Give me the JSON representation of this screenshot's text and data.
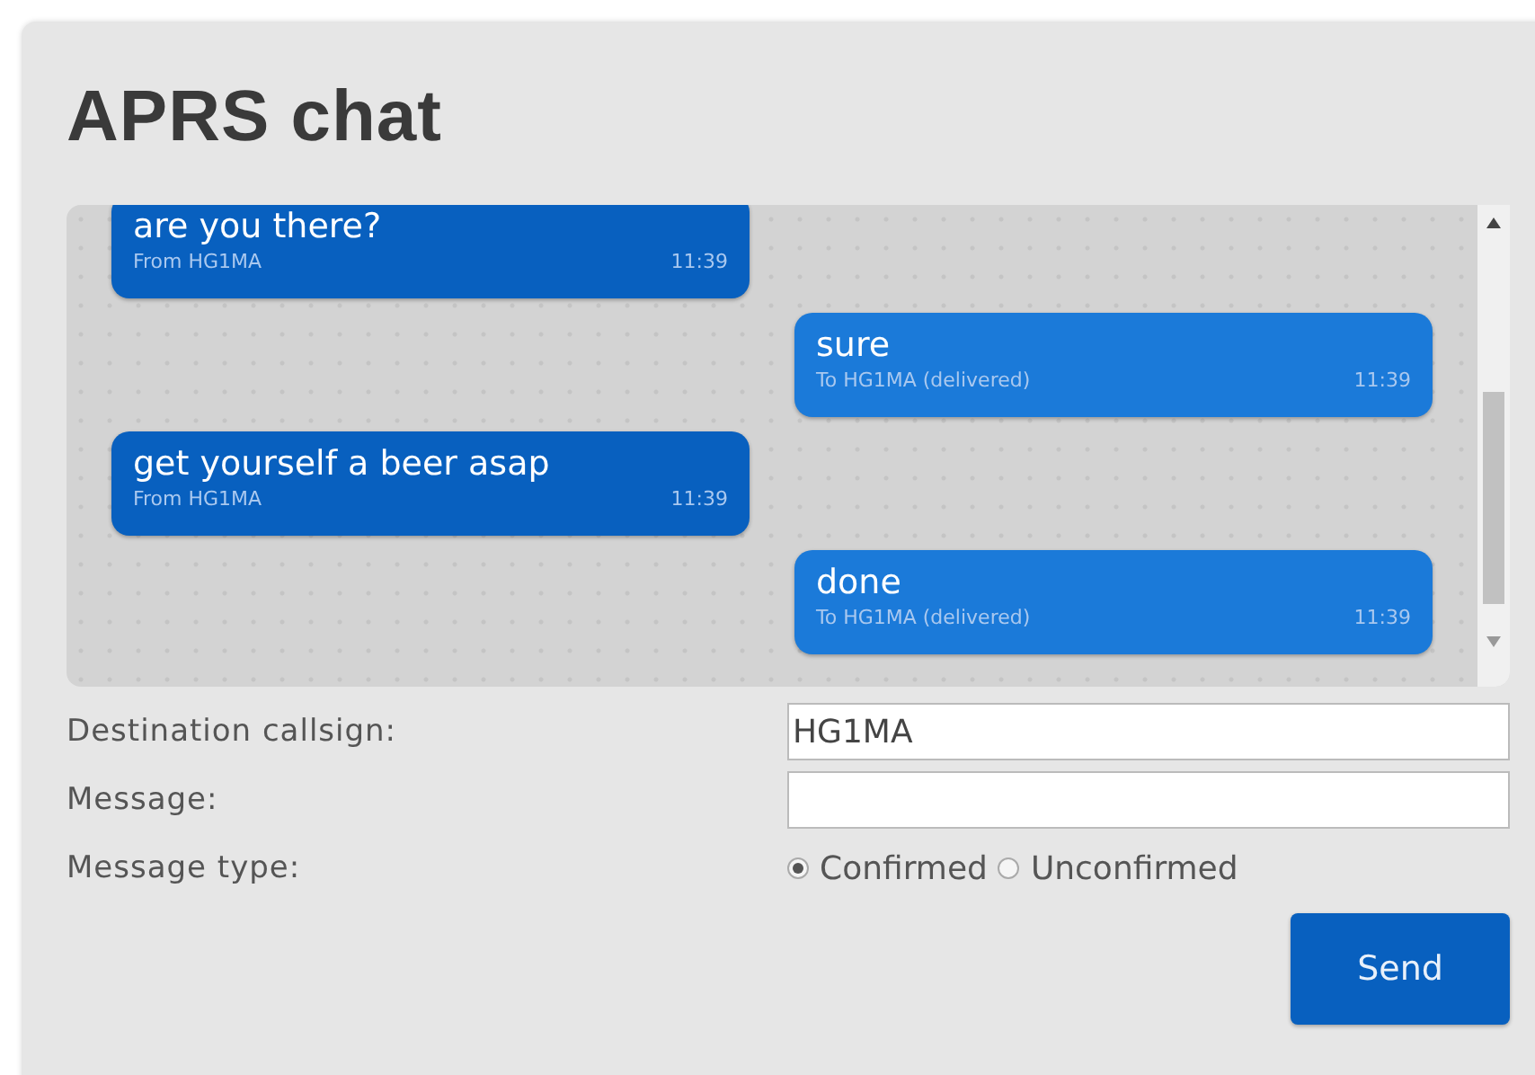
{
  "title": "APRS chat",
  "messages": [
    {
      "kind": "incoming",
      "text": "are you there?",
      "meta": "From HG1MA",
      "time": "11:39"
    },
    {
      "kind": "outgoing",
      "text": "sure",
      "meta": "To HG1MA (delivered)",
      "time": "11:39"
    },
    {
      "kind": "incoming",
      "text": "get yourself a beer asap",
      "meta": "From HG1MA",
      "time": "11:39"
    },
    {
      "kind": "outgoing",
      "text": "done",
      "meta": "To HG1MA (delivered)",
      "time": "11:39"
    }
  ],
  "form": {
    "destination": {
      "label": "Destination callsign:",
      "value": "HG1MA"
    },
    "message": {
      "label": "Message:"
    },
    "type": {
      "label": "Message type:",
      "options": [
        {
          "label": "Confirmed",
          "selected": true
        },
        {
          "label": "Unconfirmed",
          "selected": false
        }
      ]
    },
    "send": "Send"
  }
}
